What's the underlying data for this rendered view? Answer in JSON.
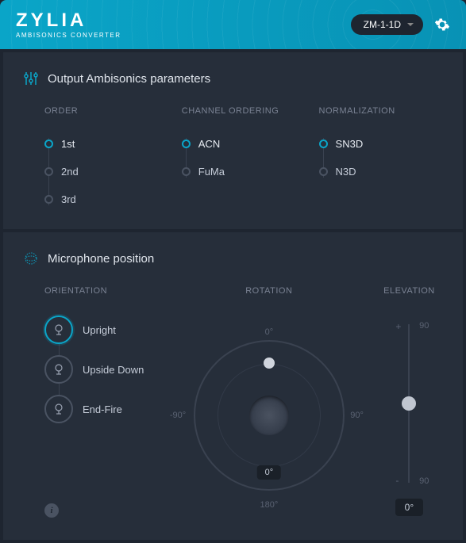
{
  "header": {
    "brand": "ZYLIA",
    "subtitle": "AMBISONICS CONVERTER",
    "device": "ZM-1-1D"
  },
  "output": {
    "title": "Output Ambisonics parameters",
    "order": {
      "label": "ORDER",
      "opts": [
        "1st",
        "2nd",
        "3rd"
      ],
      "selected": 0
    },
    "channel_ordering": {
      "label": "CHANNEL ORDERING",
      "opts": [
        "ACN",
        "FuMa"
      ],
      "selected": 0
    },
    "normalization": {
      "label": "NORMALIZATION",
      "opts": [
        "SN3D",
        "N3D"
      ],
      "selected": 0
    }
  },
  "mic": {
    "title": "Microphone position",
    "orientation": {
      "label": "ORIENTATION",
      "opts": [
        "Upright",
        "Upside Down",
        "End-Fire"
      ],
      "selected": 0
    },
    "rotation": {
      "label": "ROTATION",
      "ticks": {
        "top": "0°",
        "right": "90°",
        "bottom": "180°",
        "left": "-90°"
      },
      "value": "0°"
    },
    "elevation": {
      "label": "ELEVATION",
      "plus": "+",
      "minus": "-",
      "max": "90",
      "min": "90",
      "value": "0°"
    },
    "info": "i"
  }
}
